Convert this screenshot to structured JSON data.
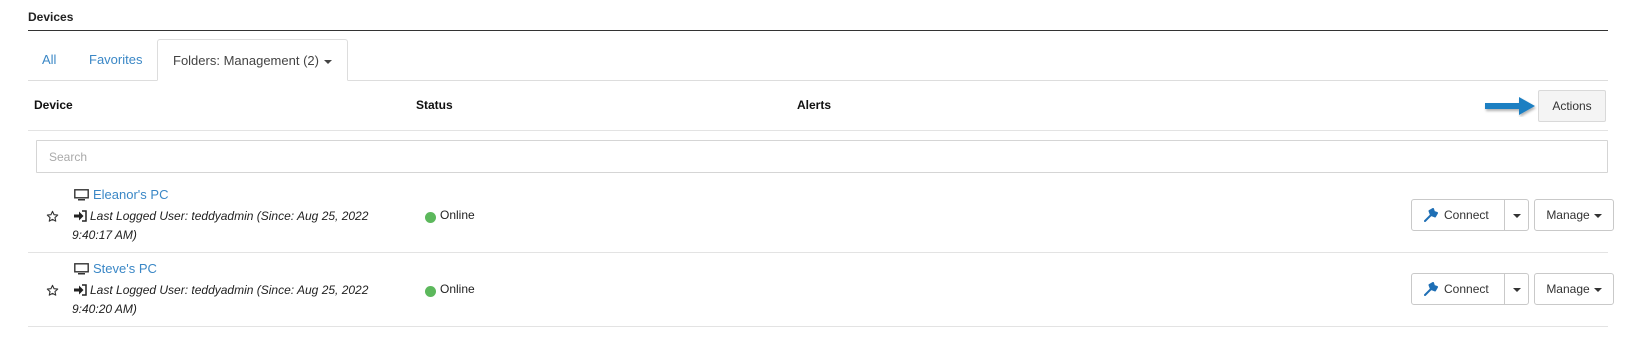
{
  "section": {
    "title": "Devices"
  },
  "tabs": [
    {
      "label": "All"
    },
    {
      "label": "Favorites"
    },
    {
      "label": "Folders: Management (2)"
    }
  ],
  "table": {
    "headers": {
      "device": "Device",
      "status": "Status",
      "alerts": "Alerts"
    },
    "actions_label": "Actions"
  },
  "search": {
    "placeholder": "Search"
  },
  "devices": [
    {
      "name": "Eleanor's PC",
      "last_user": "Last Logged User: teddyadmin (Since: Aug 25, 2022 9:40:17 AM)",
      "status": "Online",
      "connect_label": "Connect",
      "manage_label": "Manage"
    },
    {
      "name": "Steve's PC",
      "last_user": "Last Logged User: teddyadmin (Since: Aug 25, 2022 9:40:20 AM)",
      "status": "Online",
      "connect_label": "Connect",
      "manage_label": "Manage"
    }
  ],
  "colors": {
    "link": "#3a87c6",
    "online": "#5cb85c",
    "arrow": "#1f7fc2"
  },
  "icons": {
    "favorite": "star-outline-icon",
    "device": "monitor-icon",
    "login": "sign-in-icon",
    "connect": "wrench-icon",
    "annotation": "arrow-right-icon"
  }
}
